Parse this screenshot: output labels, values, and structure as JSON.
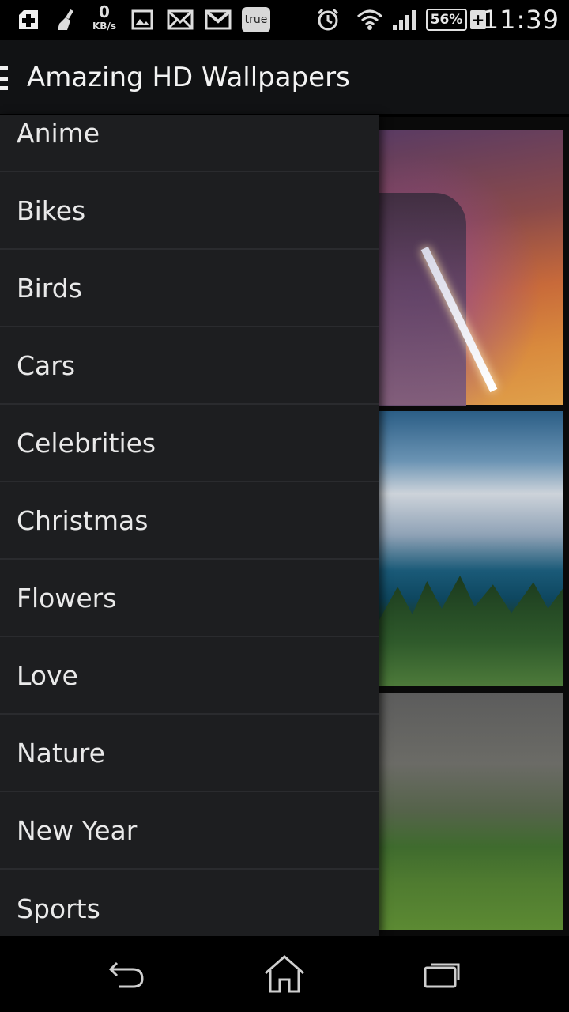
{
  "status_bar": {
    "net_speed_value": "0",
    "net_speed_unit": "KB/s",
    "true_badge": "true",
    "battery": "56%",
    "time": "11:39",
    "icons": [
      "plus-app-icon",
      "broom-icon",
      "image-icon",
      "mail-x-icon",
      "gmail-icon",
      "alarm-icon",
      "wifi-icon",
      "signal-icon",
      "battery-icon"
    ]
  },
  "app_bar": {
    "title": "Amazing HD Wallpapers"
  },
  "drawer": {
    "items": [
      {
        "label": "Anime"
      },
      {
        "label": "Bikes"
      },
      {
        "label": "Birds"
      },
      {
        "label": "Cars"
      },
      {
        "label": "Celebrities"
      },
      {
        "label": "Christmas"
      },
      {
        "label": "Flowers"
      },
      {
        "label": "Love"
      },
      {
        "label": "Nature"
      },
      {
        "label": "New Year"
      },
      {
        "label": "Sports"
      }
    ]
  },
  "content": {
    "thumbnails": [
      "anime-wallpaper",
      "lake-mountain-wallpaper",
      "green-field-wallpaper"
    ]
  },
  "nav_bar": {
    "buttons": [
      "back-icon",
      "home-icon",
      "recent-apps-icon"
    ]
  }
}
